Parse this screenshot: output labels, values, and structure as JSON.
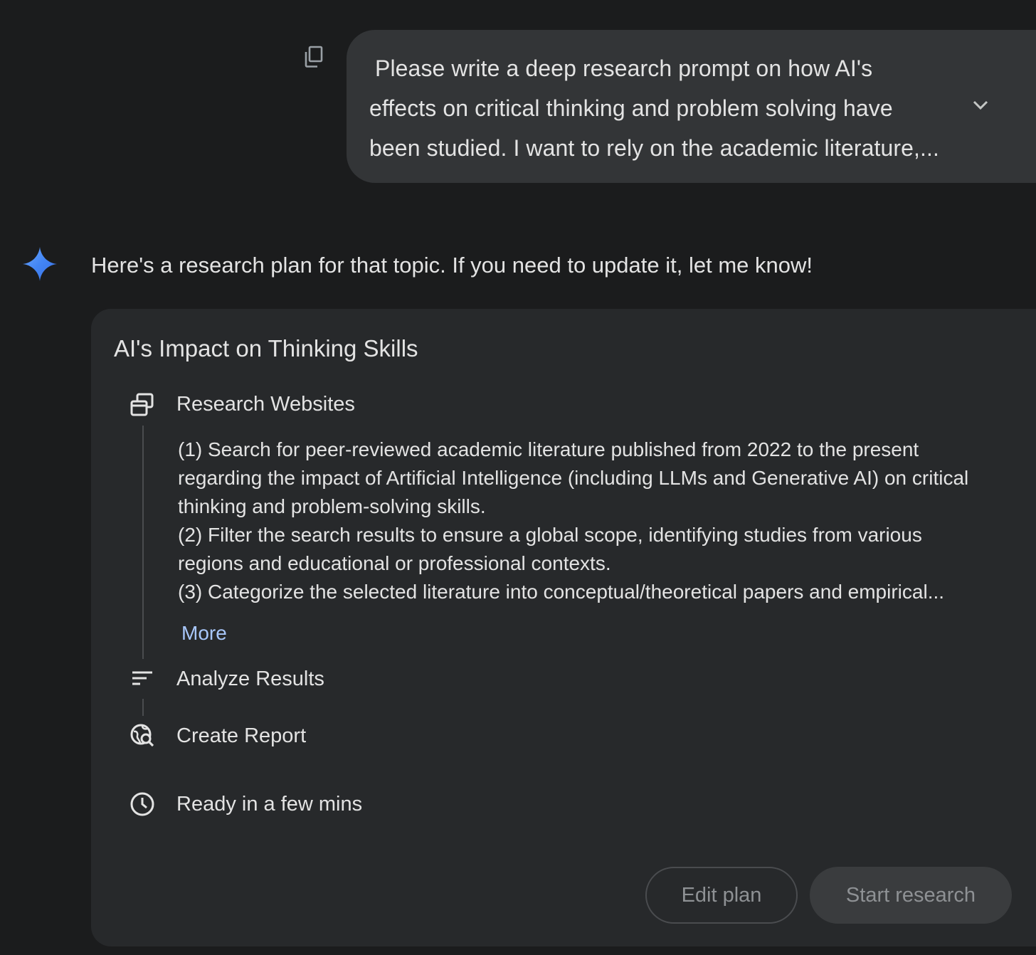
{
  "user_prompt": {
    "text": "Please write a deep research prompt on how AI's\neffects on critical thinking and problem solving have\nbeen studied. I want to rely on the academic literature,...",
    "copy_icon": "copy-icon",
    "expand_icon": "chevron-down-icon"
  },
  "response": {
    "avatar_icon": "gemini-spark-icon",
    "text": "Here's a research plan for that topic. If you need to update it, let me know!"
  },
  "plan": {
    "title": "AI's Impact on Thinking Skills",
    "steps": [
      {
        "icon": "research-websites-icon",
        "label": "Research Websites",
        "description_lines": [
          "(1) Search for peer-reviewed academic literature published from 2022 to the present",
          "regarding the impact of Artificial Intelligence (including LLMs and Generative AI) on critical",
          "thinking and problem-solving skills.",
          "(2) Filter the search results to ensure a global scope, identifying studies from various",
          "regions and educational or professional contexts.",
          "(3) Categorize the selected literature into conceptual/theoretical papers and empirical..."
        ],
        "more_label": "More"
      },
      {
        "icon": "analyze-results-icon",
        "label": "Analyze Results"
      },
      {
        "icon": "create-report-icon",
        "label": "Create Report"
      }
    ],
    "eta_icon": "clock-icon",
    "eta_text": "Ready in a few mins",
    "edit_button": "Edit plan",
    "start_button": "Start research"
  },
  "colors": {
    "background": "#1b1c1d",
    "bubble": "#333537",
    "card": "#27292b",
    "text": "#e3e3e3",
    "link": "#a8c7fa",
    "muted": "#8e9194",
    "spark_gradient": [
      "#4285f4",
      "#3b6fe0",
      "#6fa8ff"
    ]
  }
}
